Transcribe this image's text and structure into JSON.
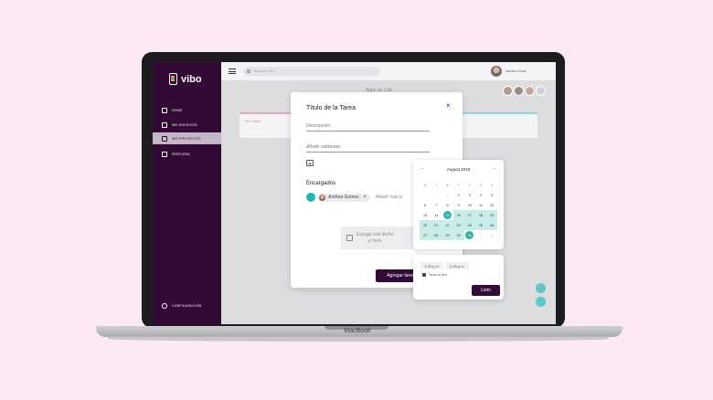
{
  "device": {
    "label": "MacBook"
  },
  "app": {
    "brand": "vibo"
  },
  "sidebar": {
    "items": [
      {
        "label": "HOME",
        "icon": "home-icon"
      },
      {
        "label": "MIS ARCHIVOS",
        "icon": "file-icon"
      },
      {
        "label": "MIS PROYECTOS",
        "icon": "projects-icon",
        "active": true
      },
      {
        "label": "PAPELERA",
        "icon": "trash-icon"
      }
    ],
    "settings": {
      "label": "CONFIGURACIÓN",
      "icon": "gear-icon"
    }
  },
  "topbar": {
    "search_placeholder": "Busca en vibo",
    "user_name": "Nombre Usuar"
  },
  "board": {
    "project_title": "Apps de Cali",
    "column_left": "Por hacer"
  },
  "modal": {
    "title": "Título de la Tarea",
    "description_placeholder": "Descripción",
    "subtasks_placeholder": "Añadir subtareas",
    "assignees_title": "Encargados",
    "assignee_name": "Andrea Gomez",
    "add_more_placeholder": "Añadir más p",
    "date_line1": "Escoge una fecha",
    "date_line2": "y hora",
    "add_button": "Agregar tarea",
    "close": "×"
  },
  "calendar": {
    "month": "August 2018",
    "prev": "←",
    "next": "→",
    "weekdays": [
      "M",
      "T",
      "W",
      "T",
      "F",
      "S",
      "S"
    ],
    "days": [
      {
        "d": "",
        "t": ""
      },
      {
        "d": "",
        "t": ""
      },
      {
        "d": "1",
        "t": "muted"
      },
      {
        "d": "2",
        "t": ""
      },
      {
        "d": "3",
        "t": ""
      },
      {
        "d": "4",
        "t": ""
      },
      {
        "d": "5",
        "t": ""
      },
      {
        "d": "6",
        "t": ""
      },
      {
        "d": "7",
        "t": ""
      },
      {
        "d": "8",
        "t": ""
      },
      {
        "d": "9",
        "t": ""
      },
      {
        "d": "10",
        "t": ""
      },
      {
        "d": "11",
        "t": ""
      },
      {
        "d": "12",
        "t": ""
      },
      {
        "d": "13",
        "t": ""
      },
      {
        "d": "14",
        "t": ""
      },
      {
        "d": "15",
        "t": "sel"
      },
      {
        "d": "16",
        "t": "range"
      },
      {
        "d": "17",
        "t": "range"
      },
      {
        "d": "18",
        "t": "range"
      },
      {
        "d": "19",
        "t": "range"
      },
      {
        "d": "20",
        "t": "range"
      },
      {
        "d": "21",
        "t": "range"
      },
      {
        "d": "22",
        "t": "range"
      },
      {
        "d": "23",
        "t": "range"
      },
      {
        "d": "24",
        "t": "range"
      },
      {
        "d": "25",
        "t": "range"
      },
      {
        "d": "26",
        "t": "range"
      },
      {
        "d": "27",
        "t": "range"
      },
      {
        "d": "28",
        "t": "range"
      },
      {
        "d": "29",
        "t": "range"
      },
      {
        "d": "30",
        "t": "range"
      },
      {
        "d": "31",
        "t": "sel"
      },
      {
        "d": "1",
        "t": "muted"
      },
      {
        "d": "2",
        "t": "muted"
      }
    ]
  },
  "time": {
    "start": "1:30 p.m.",
    "end": "2:30 p.m.",
    "all_day_label": "Todo el día",
    "done_button": "Listo"
  },
  "colors": {
    "accent": "#23b5b0",
    "brand": "#320a35",
    "background": "#fbeaf6"
  }
}
